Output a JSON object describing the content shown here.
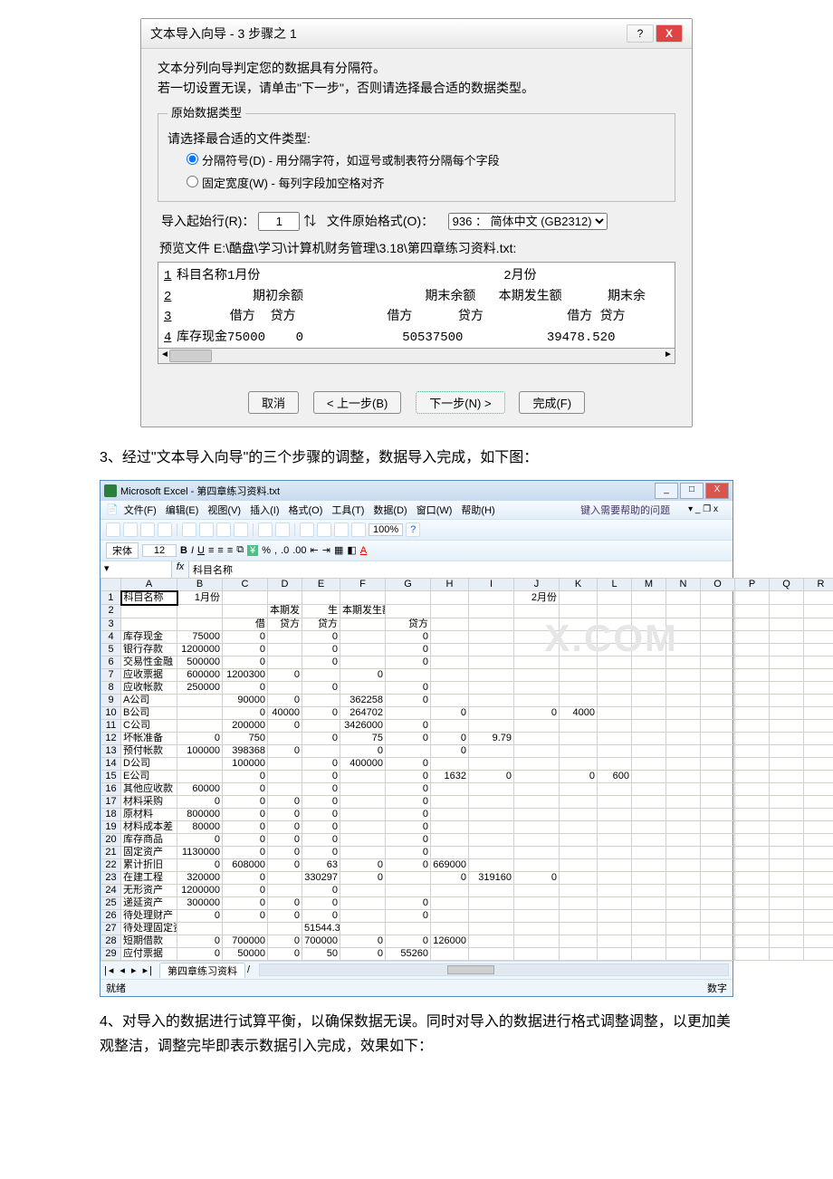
{
  "wizard": {
    "title": "文本导入向导 - 3 步骤之 1",
    "line1": "文本分列向导判定您的数据具有分隔符。",
    "line2": "若一切设置无误，请单击\"下一步\"，否则请选择最合适的数据类型。",
    "groupTitle": "原始数据类型",
    "chooseType": "请选择最合适的文件类型:",
    "optDelim": "分隔符号(D)  - 用分隔字符，如逗号或制表符分隔每个字段",
    "optFixed": "固定宽度(W)  - 每列字段加空格对齐",
    "startRowLabel": "导入起始行(R)：",
    "startRowVal": "1",
    "encodingLabel": "文件原始格式(O)：",
    "encodingVal": "936 ： 简体中文 (GB2312)",
    "previewLabel": "预览文件 E:\\酷盘\\学习\\计算机财务管理\\3.18\\第四章练习资料.txt:",
    "previewLines": [
      "科目名称1月份                                2月份",
      "          期初余额                期末余额   本期发生额      期末余",
      "       借方  贷方            借方      贷方           借方 贷方",
      "库存现金75000    0             50537500           39478.520"
    ],
    "btnCancel": "取消",
    "btnBack": "< 上一步(B)",
    "btnNext": "下一步(N) >",
    "btnFinish": "完成(F)"
  },
  "para3": "3、经过\"文本导入向导\"的三个步骤的调整，数据导入完成，如下图：",
  "para4": "    4、对导入的数据进行试算平衡，以确保数据无误。同时对导入的数据进行格式调整调整，以更加美观整洁，调整完毕即表示数据引入完成，效果如下：",
  "excel": {
    "title": "Microsoft Excel - 第四章练习资料.txt",
    "menus": [
      "文件(F)",
      "编辑(E)",
      "视图(V)",
      "插入(I)",
      "格式(O)",
      "工具(T)",
      "数据(D)",
      "窗口(W)",
      "帮助(H)"
    ],
    "helpHint": "键入需要帮助的问题",
    "fontName": "宋体",
    "fontSize": "12",
    "zoom": "100%",
    "nameBox": "",
    "formulaVal": "科目名称",
    "cols": [
      "",
      "A",
      "B",
      "C",
      "D",
      "E",
      "F",
      "G",
      "H",
      "I",
      "J",
      "K",
      "L",
      "M",
      "N",
      "O",
      "P",
      "Q",
      "R"
    ],
    "tab": "第四章练习资料",
    "statusL": "就绪",
    "statusR": "数字",
    "rows": [
      [
        "1",
        "科目名称",
        "1月份",
        "",
        "",
        "",
        "",
        "",
        "",
        "",
        "2月份",
        "",
        "",
        "",
        "",
        "",
        "",
        "",
        ""
      ],
      [
        "2",
        "",
        "",
        "",
        "本期发",
        "生",
        "本期发生额",
        "",
        "",
        "",
        "",
        "",
        "",
        "",
        "",
        "",
        "",
        "",
        ""
      ],
      [
        "3",
        "",
        "",
        "借",
        "贷方",
        "贷方",
        "",
        "贷方",
        "",
        "",
        "",
        "",
        "",
        "",
        "",
        "",
        "",
        "",
        ""
      ],
      [
        "4",
        "库存现金",
        "75000",
        "0",
        "",
        "0",
        "",
        "0",
        "",
        "",
        "",
        "",
        "",
        "",
        "",
        "",
        "",
        "",
        ""
      ],
      [
        "5",
        "银行存款",
        "1200000",
        "0",
        "",
        "0",
        "",
        "0",
        "",
        "",
        "",
        "",
        "",
        "",
        "",
        "",
        "",
        "",
        ""
      ],
      [
        "6",
        "交易性金融",
        "500000",
        "0",
        "",
        "0",
        "",
        "0",
        "",
        "",
        "",
        "",
        "",
        "",
        "",
        "",
        "",
        "",
        ""
      ],
      [
        "7",
        "应收票据",
        "600000",
        "1200300",
        "0",
        "",
        "0",
        "",
        "",
        "",
        "",
        "",
        "",
        "",
        "",
        "",
        "",
        "",
        ""
      ],
      [
        "8",
        "应收帐款",
        "250000",
        "0",
        "",
        "0",
        "",
        "0",
        "",
        "",
        "",
        "",
        "",
        "",
        "",
        "",
        "",
        "",
        ""
      ],
      [
        "9",
        "A公司",
        "",
        "90000",
        "0",
        "",
        "362258",
        "0",
        "",
        "",
        "",
        "",
        "",
        "",
        "",
        "",
        "",
        "",
        ""
      ],
      [
        "10",
        "B公司",
        "",
        "0",
        "40000",
        "0",
        "264702",
        "",
        "0",
        "",
        "0",
        "4000",
        "",
        "",
        "",
        "",
        "",
        "",
        ""
      ],
      [
        "11",
        "C公司",
        "",
        "200000",
        "0",
        "",
        "3426000",
        "0",
        "",
        "",
        "",
        "",
        "",
        "",
        "",
        "",
        "",
        "",
        ""
      ],
      [
        "12",
        "坏帐准备",
        "0",
        "750",
        "",
        "0",
        "75",
        "0",
        "0",
        "9.79",
        "",
        "",
        "",
        "",
        "",
        "",
        "",
        "",
        ""
      ],
      [
        "13",
        "预付帐款",
        "100000",
        "398368",
        "0",
        "",
        "0",
        "",
        "0",
        "",
        "",
        "",
        "",
        "",
        "",
        "",
        "",
        "",
        ""
      ],
      [
        "14",
        "D公司",
        "",
        "100000",
        "",
        "0",
        "400000",
        "0",
        "",
        "",
        "",
        "",
        "",
        "",
        "",
        "",
        "",
        "",
        ""
      ],
      [
        "15",
        "E公司",
        "",
        "0",
        "",
        "0",
        "",
        "0",
        "1632",
        "0",
        "",
        "0",
        "600",
        "",
        "",
        "",
        "",
        "",
        ""
      ],
      [
        "16",
        "其他应收款",
        "60000",
        "0",
        "",
        "0",
        "",
        "0",
        "",
        "",
        "",
        "",
        "",
        "",
        "",
        "",
        "",
        "",
        ""
      ],
      [
        "17",
        "材料采购",
        "0",
        "0",
        "0",
        "0",
        "",
        "0",
        "",
        "",
        "",
        "",
        "",
        "",
        "",
        "",
        "",
        "",
        ""
      ],
      [
        "18",
        "原材料",
        "800000",
        "0",
        "0",
        "0",
        "",
        "0",
        "",
        "",
        "",
        "",
        "",
        "",
        "",
        "",
        "",
        "",
        ""
      ],
      [
        "19",
        "材料成本差",
        "80000",
        "0",
        "0",
        "0",
        "",
        "0",
        "",
        "",
        "",
        "",
        "",
        "",
        "",
        "",
        "",
        "",
        ""
      ],
      [
        "20",
        "库存商品",
        "0",
        "0",
        "0",
        "0",
        "",
        "0",
        "",
        "",
        "",
        "",
        "",
        "",
        "",
        "",
        "",
        "",
        ""
      ],
      [
        "21",
        "固定资产",
        "1130000",
        "0",
        "0",
        "0",
        "",
        "0",
        "",
        "",
        "",
        "",
        "",
        "",
        "",
        "",
        "",
        "",
        ""
      ],
      [
        "22",
        "累计折旧",
        "0",
        "608000",
        "0",
        "63",
        "0",
        "0",
        "669000",
        "",
        "",
        "",
        "",
        "",
        "",
        "",
        "",
        "",
        ""
      ],
      [
        "23",
        "在建工程",
        "320000",
        "0",
        "",
        "330297",
        "0",
        "",
        "0",
        "319160",
        "0",
        "",
        "",
        "",
        "",
        "",
        "",
        "",
        ""
      ],
      [
        "24",
        "无形资产",
        "1200000",
        "0",
        "",
        "0",
        "",
        "",
        "",
        "",
        "",
        "",
        "",
        "",
        "",
        "",
        "",
        "",
        ""
      ],
      [
        "25",
        "递延资产",
        "300000",
        "0",
        "0",
        "0",
        "",
        "0",
        "",
        "",
        "",
        "",
        "",
        "",
        "",
        "",
        "",
        "",
        ""
      ],
      [
        "26",
        "待处理财产",
        "0",
        "0",
        "0",
        "0",
        "",
        "0",
        "",
        "",
        "",
        "",
        "",
        "",
        "",
        "",
        "",
        "",
        ""
      ],
      [
        "27",
        "待处理固定资产损溢",
        "",
        "",
        "",
        "51544.3",
        "",
        "",
        "",
        "",
        "",
        "",
        "",
        "",
        "",
        "",
        "",
        "",
        ""
      ],
      [
        "28",
        "短期借款",
        "0",
        "700000",
        "0",
        "700000",
        "0",
        "0",
        "126000",
        "",
        "",
        "",
        "",
        "",
        "",
        "",
        "",
        "",
        ""
      ],
      [
        "29",
        "应付票据",
        "0",
        "50000",
        "0",
        "50",
        "0",
        "55260",
        "",
        "",
        "",
        "",
        "",
        "",
        "",
        "",
        "",
        "",
        ""
      ]
    ]
  },
  "watermark": "X.COM"
}
